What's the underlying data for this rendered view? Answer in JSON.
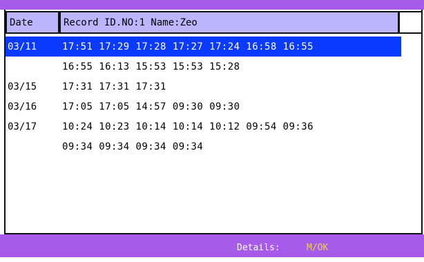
{
  "header": {
    "date_label": "Date",
    "record_label": "Record ID.NO:1 Name:Zeo",
    "blank_label": ""
  },
  "rows": [
    {
      "date": "03/11",
      "times": "17:51 17:29 17:28 17:27 17:24 16:58 16:55",
      "selected": true
    },
    {
      "date": "",
      "times": "16:55 16:13 15:53 15:53 15:28",
      "selected": false
    },
    {
      "date": "03/15",
      "times": "17:31 17:31 17:31",
      "selected": false
    },
    {
      "date": "03/16",
      "times": "17:05 17:05 14:57 09:30 09:30",
      "selected": false
    },
    {
      "date": "03/17",
      "times": "10:24 10:23 10:14 10:14 10:12 09:54 09:36",
      "selected": false
    },
    {
      "date": "",
      "times": "09:34 09:34 09:34 09:34",
      "selected": false
    }
  ],
  "footer": {
    "details_label": "Details:",
    "details_key": "M/OK"
  },
  "colors": {
    "bar_purple": "#a65ce8",
    "header_lavender": "#bcb6ff",
    "selection_blue": "#0a3aff",
    "key_yellow": "#f6d23a"
  }
}
